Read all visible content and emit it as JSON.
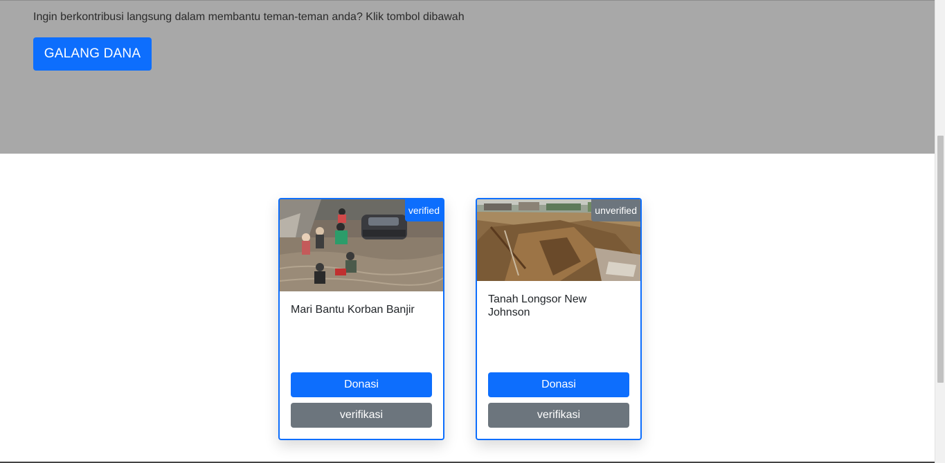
{
  "hero": {
    "text": "Ingin berkontribusi langsung dalam membantu teman-teman anda? Klik tombol dibawah",
    "button_label": "GALANG DANA"
  },
  "campaigns": [
    {
      "title": "Mari Bantu Korban Banjir",
      "status": "verified",
      "image": "flood-photo",
      "donate_label": "Donasi",
      "verify_label": "verifikasi"
    },
    {
      "title": "Tanah Longsor New Johnson",
      "status": "unverified",
      "image": "landslide-photo",
      "donate_label": "Donasi",
      "verify_label": "verifikasi"
    }
  ],
  "colors": {
    "primary": "#0d6efd",
    "secondary": "#6c757d",
    "hero_bg": "#a8a8a8"
  }
}
